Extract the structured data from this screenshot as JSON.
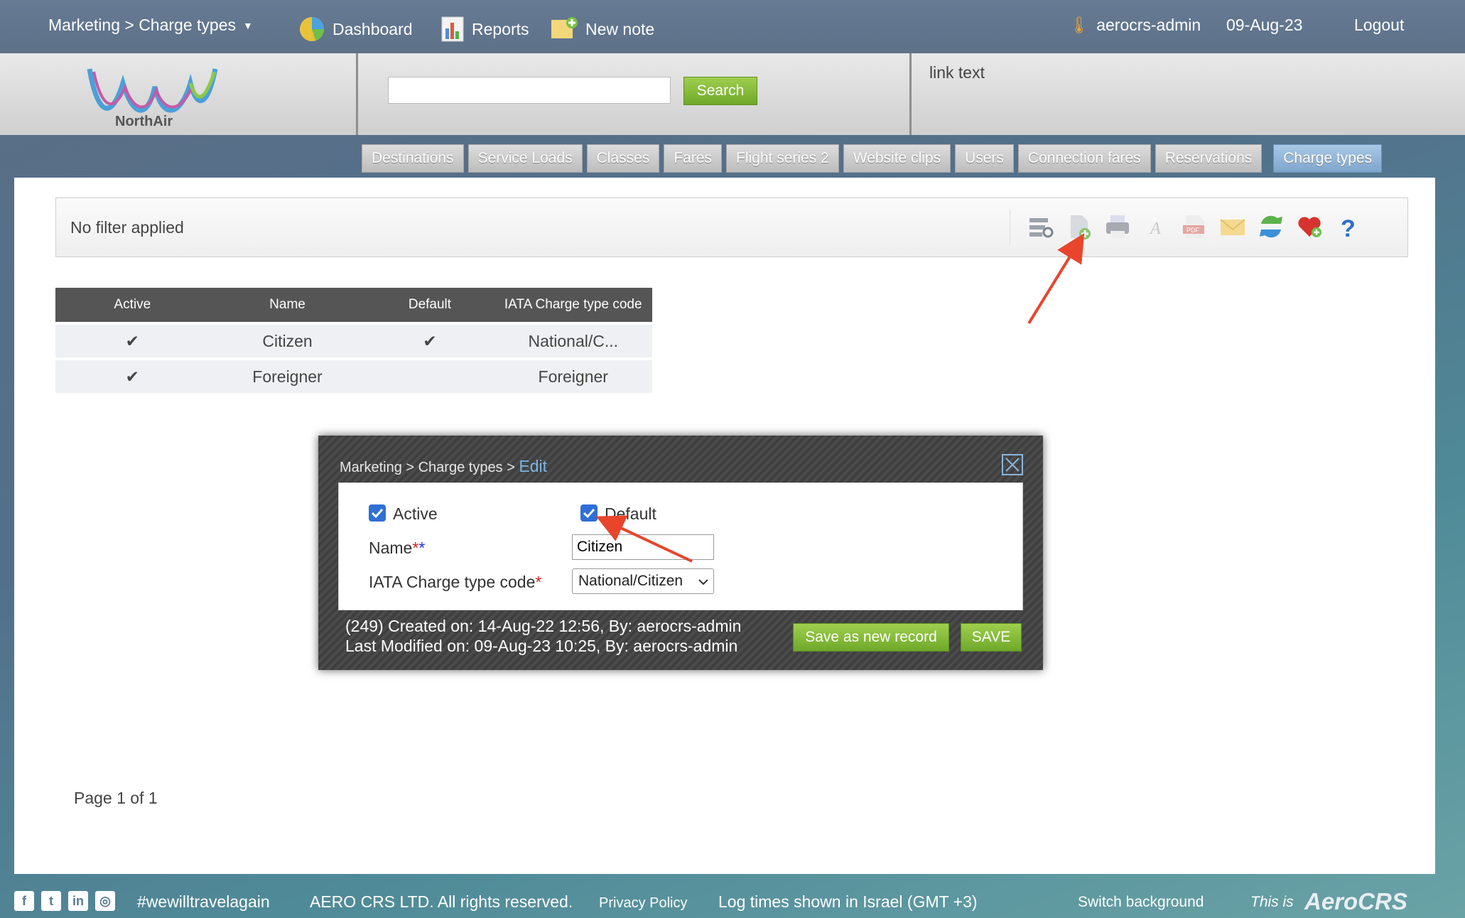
{
  "topbar": {
    "breadcrumb_menu": "Marketing > Charge types",
    "dashboard": "Dashboard",
    "reports": "Reports",
    "new_note": "New note",
    "user": "aerocrs-admin",
    "date": "09-Aug-23",
    "logout": "Logout"
  },
  "header": {
    "logo_text": "NorthAir",
    "search_value": "",
    "search_button": "Search",
    "link_text": "link text"
  },
  "tabs": [
    "Destinations",
    "Service Loads",
    "Classes",
    "Fares",
    "Flight series 2",
    "Website clips",
    "Users",
    "Connection fares",
    "Reservations",
    "Charge types"
  ],
  "active_tab": "Charge types",
  "filter": {
    "label": "No filter applied"
  },
  "toolbar_icons": [
    "filter-icon",
    "add-record-icon",
    "print-icon",
    "font-icon",
    "pdf-icon",
    "email-icon",
    "refresh-icon",
    "favorite-icon",
    "help-icon"
  ],
  "table": {
    "headers": [
      "Active",
      "Name",
      "Default",
      "IATA Charge type code"
    ],
    "rows": [
      {
        "active": "✔",
        "name": "Citizen",
        "default": "✔",
        "code": "National/C..."
      },
      {
        "active": "✔",
        "name": "Foreigner",
        "default": "",
        "code": "Foreigner"
      }
    ]
  },
  "pager": "Page 1 of 1",
  "modal": {
    "crumb": "Marketing > Charge types > ",
    "crumb_edit": "Edit",
    "active_label": "Active",
    "active_checked": true,
    "default_label": "Default",
    "default_checked": true,
    "name_label": "Name",
    "name_req": "*",
    "name_req2": "*",
    "name_value": "Citizen",
    "code_label": "IATA Charge type code",
    "code_req": "*",
    "code_value": "National/Citizen",
    "meta_line1": "(249) Created on: 14-Aug-22 12:56, By: aerocrs-admin",
    "meta_line2": "Last Modified on: 09-Aug-23 10:25, By: aerocrs-admin",
    "save_new_button": "Save as new record",
    "save_button": "SAVE"
  },
  "footer": {
    "hashtag": "#wewilltravelagain",
    "copyright": "AERO CRS LTD. All rights reserved.",
    "privacy": "Privacy Policy",
    "log_times": "Log times shown in Israel (GMT +3)",
    "switch_bg": "Switch background",
    "this_is": "This is",
    "brand": "AeroCRS"
  },
  "colors": {
    "accent_green": "#7ab536",
    "tab_active": "#8fb3d6",
    "annotation_arrow": "#e8452c"
  }
}
